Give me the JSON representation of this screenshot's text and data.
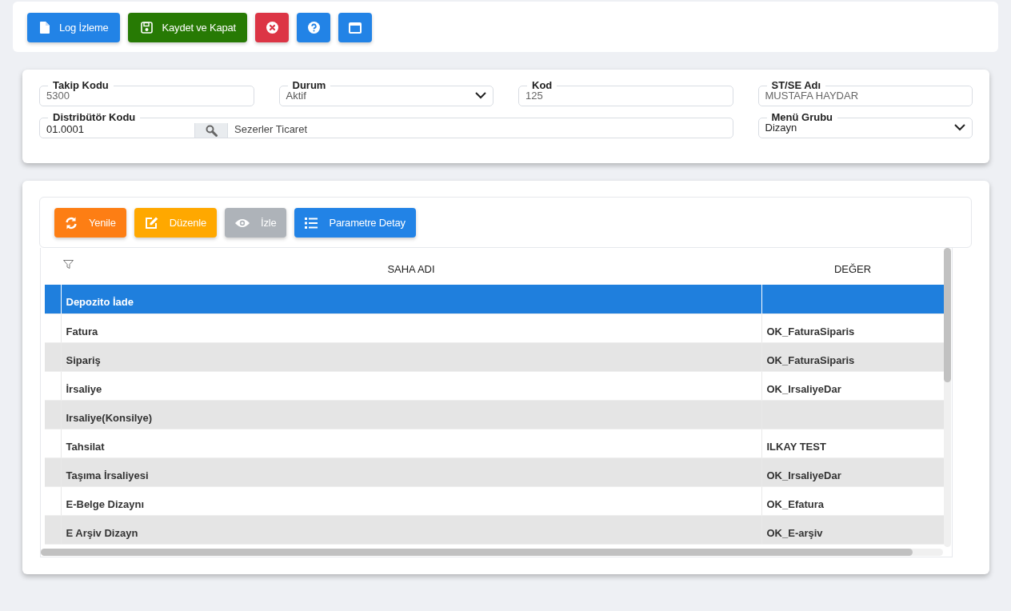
{
  "toolbar": {
    "buttons": [
      {
        "kind": "log",
        "label": "Log İzleme"
      },
      {
        "kind": "save",
        "label": "Kaydet ve Kapat"
      },
      {
        "kind": "close"
      },
      {
        "kind": "help"
      },
      {
        "kind": "window"
      }
    ]
  },
  "form": {
    "row_1": [
      {
        "kind": "text",
        "label": "Takip Kodu",
        "value": "5300"
      },
      {
        "kind": "select",
        "label": "Durum",
        "value": "Aktif"
      },
      {
        "kind": "text",
        "label": "Kod",
        "value": "125"
      },
      {
        "kind": "text",
        "label": "ST/SE Adı",
        "value": "MUSTAFA HAYDAR"
      }
    ],
    "distributor": {
      "label": "Distribütör Kodu",
      "code": "01.0001",
      "name": "Sezerler Ticaret"
    },
    "menu_group": {
      "label": "Menü Grubu",
      "value": "Dizayn"
    }
  },
  "grid": {
    "toolbar": [
      {
        "kind": "refresh",
        "label": "Yenile",
        "disabled": false
      },
      {
        "kind": "edit",
        "label": "Düzenle",
        "disabled": false
      },
      {
        "kind": "view",
        "label": "İzle",
        "disabled": true
      },
      {
        "kind": "list",
        "label": "Parametre Detay",
        "disabled": false
      }
    ],
    "columns": [
      "SAHA ADI",
      "DEĞER"
    ],
    "rows": [
      {
        "field": "Depozito İade",
        "value": "",
        "selected": true
      },
      {
        "field": "Fatura",
        "value": "OK_FaturaSiparis",
        "selected": false
      },
      {
        "field": "Sipariş",
        "value": "OK_FaturaSiparis",
        "selected": false
      },
      {
        "field": "İrsaliye",
        "value": "OK_IrsaliyeDar",
        "selected": false
      },
      {
        "field": "Irsaliye(Konsilye)",
        "value": "",
        "selected": false
      },
      {
        "field": "Tahsilat",
        "value": "ILKAY TEST",
        "selected": false
      },
      {
        "field": "Taşıma İrsaliyesi",
        "value": "OK_IrsaliyeDar",
        "selected": false
      },
      {
        "field": "E-Belge Dizaynı",
        "value": "OK_Efatura",
        "selected": false
      },
      {
        "field": "E Arşiv Dizayn",
        "value": "OK_E-arşiv",
        "selected": false
      }
    ]
  }
}
